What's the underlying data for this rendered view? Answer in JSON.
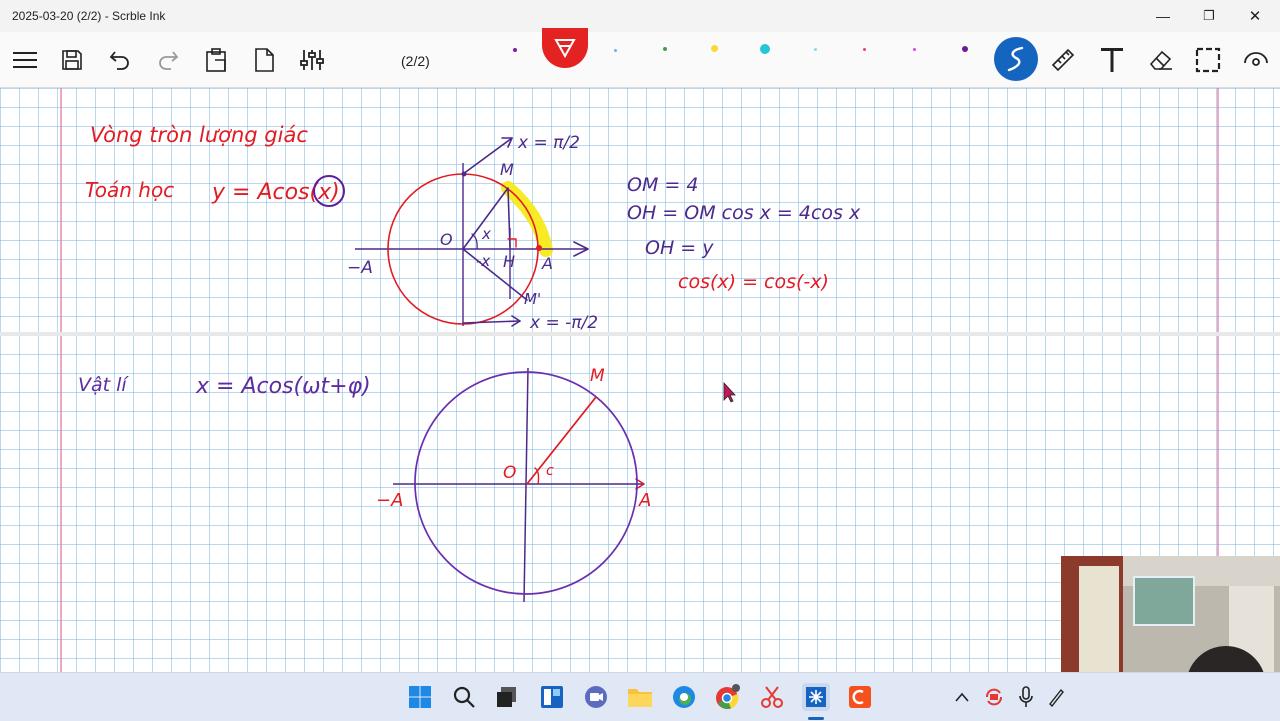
{
  "window": {
    "title": "2025-03-20 (2/2) - Scrble Ink",
    "minimize_label": "—",
    "restore_label": "❐",
    "close_label": "✕"
  },
  "toolbar": {
    "page_indicator": "(2/2)",
    "icons": [
      "menu-icon",
      "save-icon",
      "undo-icon",
      "redo-icon",
      "clipboard-icon",
      "page-icon",
      "settings-sliders-icon",
      "pen-icon",
      "ruler-icon",
      "text-icon",
      "eraser-icon",
      "select-icon",
      "view-icon"
    ],
    "pen_colors": [
      "#7b1fa2",
      "#e53935",
      "#64b5f6",
      "#43a047",
      "#fdd835",
      "#26c6da",
      "#80deea",
      "#ec407a",
      "#e040fb",
      "#6a1b9a"
    ],
    "active_pen_color": "#e52222",
    "accent": "#1565c0"
  },
  "notes": {
    "section1": {
      "title": "Vòng tròn lượng giác",
      "subject": "Toán học",
      "formula": "y = Acos(x)",
      "labels": {
        "M": "M",
        "M_prime": "M'",
        "O": "O",
        "H": "H",
        "A": "A",
        "neg_A": "−A",
        "x_angle": "x",
        "neg_x_angle": "-x",
        "top_arrow": "x = π/2",
        "bottom_arrow": "x = -π/2"
      },
      "equations": [
        "OM = 4",
        "OH = OM cos x = 4cos x",
        "OH = y",
        "cos(x) = cos(-x)"
      ]
    },
    "section2": {
      "subject": "Vật lí",
      "formula": "x = Acos(ωt+φ)",
      "labels": {
        "M": "M",
        "O": "O",
        "A": "A",
        "neg_A": "−A",
        "angle": "c"
      }
    }
  },
  "taskbar": {
    "icons": [
      "windows-start-icon",
      "search-icon",
      "task-view-icon",
      "widgets-icon",
      "meet-icon",
      "file-explorer-icon",
      "edge-icon",
      "chrome-icon",
      "snipping-tool-icon",
      "scrble-ink-icon",
      "presenter-icon"
    ],
    "tray_icons": [
      "chevron-up-icon",
      "sync-icon",
      "microphone-icon",
      "pen-tray-icon"
    ]
  },
  "webcam": {
    "description_icon": "webcam-feed"
  }
}
